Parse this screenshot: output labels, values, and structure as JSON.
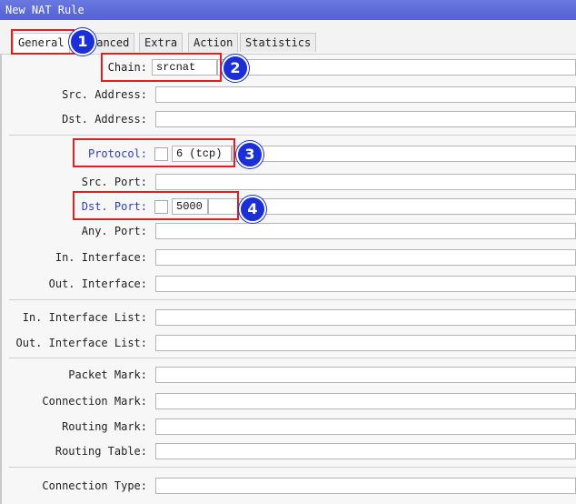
{
  "window": {
    "title": "New NAT Rule"
  },
  "tabs": [
    {
      "label": "General"
    },
    {
      "label": "Advanced"
    },
    {
      "label": "Extra"
    },
    {
      "label": "Action"
    },
    {
      "label": "Statistics"
    }
  ],
  "tab_partial_label": "vanced",
  "fields": {
    "chain": {
      "label": "Chain:",
      "value": "srcnat"
    },
    "src_address": {
      "label": "Src. Address:"
    },
    "dst_address": {
      "label": "Dst. Address:"
    },
    "protocol": {
      "label": "Protocol:",
      "value": "6 (tcp)"
    },
    "src_port": {
      "label": "Src. Port:"
    },
    "dst_port": {
      "label": "Dst. Port:",
      "value": "5000"
    },
    "any_port": {
      "label": "Any. Port:"
    },
    "in_interface": {
      "label": "In. Interface:"
    },
    "out_interface": {
      "label": "Out. Interface:"
    },
    "in_interface_list": {
      "label": "In. Interface List:"
    },
    "out_interface_list": {
      "label": "Out. Interface List:"
    },
    "packet_mark": {
      "label": "Packet Mark:"
    },
    "connection_mark": {
      "label": "Connection Mark:"
    },
    "routing_mark": {
      "label": "Routing Mark:"
    },
    "routing_table": {
      "label": "Routing Table:"
    },
    "connection_type": {
      "label": "Connection Type:"
    }
  },
  "annotations": [
    "1",
    "2",
    "3",
    "4"
  ],
  "colors": {
    "titlebar": "#5a67d8",
    "highlight": "#e02020",
    "badge": "#1a2fd8",
    "link_label": "#2c3fc4"
  }
}
